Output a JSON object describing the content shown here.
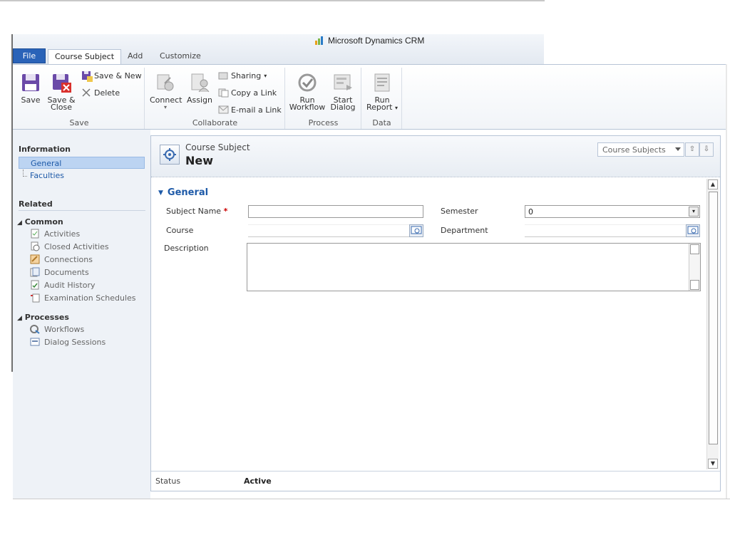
{
  "app": {
    "brand": "Microsoft Dynamics CRM"
  },
  "tabs": [
    {
      "label": "File"
    },
    {
      "label": "Course Subject"
    },
    {
      "label": "Add"
    },
    {
      "label": "Customize"
    }
  ],
  "ribbon": {
    "save_group": {
      "label": "Save",
      "save": "Save",
      "save_close_1": "Save &",
      "save_close_2": "Close",
      "save_new": "Save & New",
      "delete": "Delete"
    },
    "collaborate_group": {
      "label": "Collaborate",
      "connect": "Connect",
      "assign": "Assign",
      "sharing": "Sharing",
      "copy_link": "Copy a Link",
      "email_link": "E-mail a Link"
    },
    "process_group": {
      "label": "Process",
      "run_workflow_1": "Run",
      "run_workflow_2": "Workflow",
      "start_dialog_1": "Start",
      "start_dialog_2": "Dialog"
    },
    "data_group": {
      "label": "Data",
      "run_report_1": "Run",
      "run_report_2": "Report"
    }
  },
  "nav": {
    "information": "Information",
    "general": "General",
    "faculties": "Faculties",
    "related": "Related",
    "common": "Common",
    "common_items": [
      "Activities",
      "Closed Activities",
      "Connections",
      "Documents",
      "Audit History",
      "Examination Schedules"
    ],
    "processes": "Processes",
    "process_items": [
      "Workflows",
      "Dialog Sessions"
    ]
  },
  "record": {
    "entity_type": "Course Subject",
    "name": "New",
    "view_selector": "Course Subjects"
  },
  "form": {
    "section": "General",
    "subject_name_label": "Subject Name",
    "required_mark": "*",
    "subject_name_value": "",
    "semester_label": "Semester",
    "semester_value": "0",
    "course_label": "Course",
    "course_value": "",
    "department_label": "Department",
    "department_value": "",
    "description_label": "Description",
    "description_value": ""
  },
  "status": {
    "label": "Status",
    "value": "Active"
  }
}
